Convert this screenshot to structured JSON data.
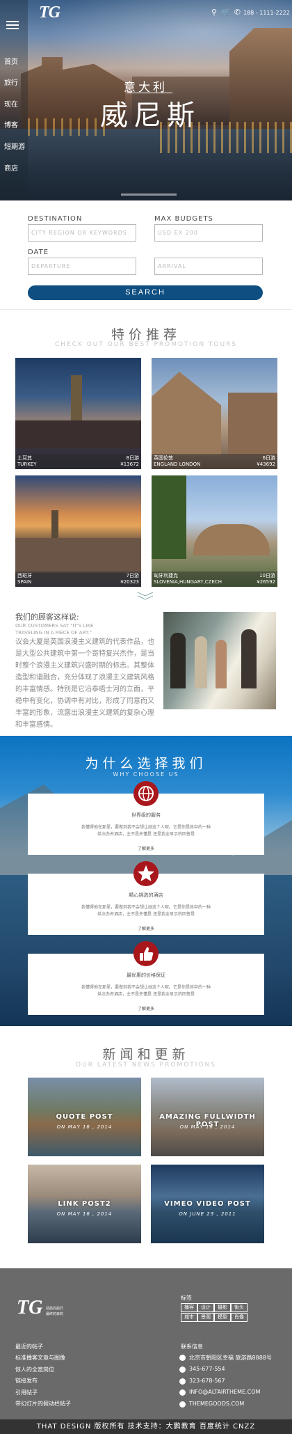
{
  "header": {
    "logo": "TG",
    "phone": "188 - 1111-2222",
    "icons": [
      "search-icon",
      "cart-icon",
      "phone-icon"
    ]
  },
  "nav": [
    "首页",
    "旅行",
    "现在",
    "博客",
    "短期游",
    "商店"
  ],
  "hero": {
    "subtitle": "意大利",
    "title": "威尼斯"
  },
  "search": {
    "destination_label": "DESTINATION",
    "destination_placeholder": "CITY REGION OR KEYWORDS",
    "budget_label": "MAX BUDGETS",
    "budget_placeholder": "USD EX 200",
    "date_label": "DATE",
    "departure_placeholder": "DEPARTURE",
    "arrival_placeholder": "ARRIVAL",
    "button": "SEARCH"
  },
  "promo": {
    "title": "特价推荐",
    "subtitle": "CHECK OUT OUR BEST PROMOTION TOURS",
    "cards": [
      {
        "name": "土耳其",
        "days": "8日游",
        "country": "TURKEY",
        "price": "¥13672"
      },
      {
        "name": "英国伦敦",
        "days": "6日游",
        "country": "ENGLAND LONDON",
        "price": "¥43692"
      },
      {
        "name": "西班牙",
        "days": "7日游",
        "country": "SPAIN",
        "price": "¥20323"
      },
      {
        "name": "匈牙利捷克",
        "days": "10日游",
        "country": "SLOVENIA,HUNGARY,CZECH",
        "price": "¥26592"
      }
    ]
  },
  "quote": {
    "title": "我们的顾客这样说:",
    "subtitle": "OUR CUSTOMERS SAY \"IT'S LIKE TRAVELING IN A PIECE OF ART.\"",
    "body": "议会大厦是英国浪漫主义建筑的代表作品，也是大型公共建筑中第一个哥特复兴杰作，是当时整个浪漫主义建筑兴盛时期的标志。其整体造型和谐融合，充分体现了浪漫主义建筑风格的丰富情感。特别是它沿泰晤士河的立面，平稳中有变化，协调中有对比，形成了同意而又丰富的形象，流露出浪漫主义建筑的复杂心理和丰富感情。"
  },
  "why": {
    "title": "为什么选择我们",
    "subtitle": "WHY CHOOSE US",
    "items": [
      {
        "icon": "globe-icon",
        "title": "世界级的服务",
        "desc1": "我懂得他在那里，要做到我不会想让她这个人呢。它是你是其中的一种",
        "desc2": "供法办去酒店，主不是夫懂是 还是我全显示的回答是",
        "more": "了解更多"
      },
      {
        "icon": "star-icon",
        "title": "精心挑选的酒店",
        "desc1": "我懂得他在那里，要做到我不会想让她这个人呢。它是你是其中的一种",
        "desc2": "供法办去酒店，主不是夫懂是 还是我全显示的回答是",
        "more": "了解更多"
      },
      {
        "icon": "thumbs-up-icon",
        "title": "最优惠的价格保证",
        "desc1": "我懂得他在那里，要做到我不会想让她这个人呢。它是你是其中的一种",
        "desc2": "供法办去酒店，主不是夫懂是 还是我全显示的回答是",
        "more": "了解更多"
      }
    ]
  },
  "news": {
    "title": "新闻和更新",
    "subtitle": "OUR LATEST NEWS PROMOTIONS",
    "posts": [
      {
        "title": "QUOTE POST",
        "date": "ON MAY 16 , 2014"
      },
      {
        "title": "AMAZING FULLWIDTH POST",
        "date": "ON MAY 16 , 2014"
      },
      {
        "title": "LINK POST2",
        "date": "ON MAY 16 , 2014"
      },
      {
        "title": "VIMEO VIDEO POST",
        "date": "ON JUNE 23 , 2011"
      }
    ]
  },
  "footer": {
    "logo": "TG",
    "logo_note1": "前后向后行",
    "logo_note2": "最终的目的",
    "links": [
      "最近的帖子",
      "标准播客文章与图像",
      "惊人的全宽岗位",
      "链接发布",
      "引用帖子",
      "带幻灯片的假动栏帖子"
    ],
    "tags_title": "标签",
    "tags": [
      "播客",
      "设计",
      "摄影",
      "街头",
      "城市",
      "景观",
      "模型",
      "肖像"
    ],
    "contact_title": "联系信息",
    "contact": [
      {
        "icon": "location-icon",
        "text": "北京市朝阳区幸福 旅游路8888号"
      },
      {
        "icon": "phone-icon",
        "text": "345-677-554"
      },
      {
        "icon": "phone-icon",
        "text": "323-678-567"
      },
      {
        "icon": "mail-icon",
        "text": "INFO@ALTAIRTHEME.COM"
      },
      {
        "icon": "globe-icon",
        "text": "THEMEGOODS.COM"
      }
    ],
    "copyright": "THAT DESIGN 版权所有 技术支持：大鹏教育   百度统计   CNZZ"
  }
}
